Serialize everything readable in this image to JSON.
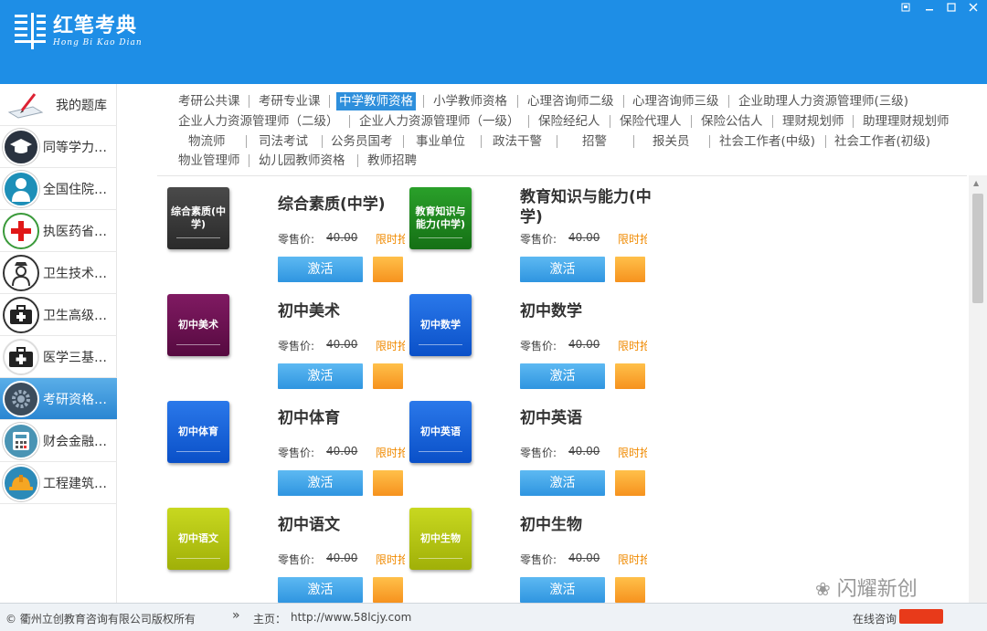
{
  "app": {
    "logo_cn": "红笔考典",
    "logo_en": "Hong Bi Kao Dian"
  },
  "colors": {
    "titlebar": "#1e8ee6",
    "accent": "#2e8fdc",
    "limited": "#f08a00"
  },
  "sidebar": {
    "items": [
      {
        "label": "我的题库",
        "icon": "pen-paper-icon"
      },
      {
        "label": "同等学力…",
        "icon": "graduation-cap-icon"
      },
      {
        "label": "全国住院…",
        "icon": "doctor-icon"
      },
      {
        "label": "执医药省…",
        "icon": "red-cross-icon"
      },
      {
        "label": "卫生技术…",
        "icon": "nurse-icon"
      },
      {
        "label": "卫生高级…",
        "icon": "medical-kit-icon"
      },
      {
        "label": "医学三基…",
        "icon": "first-aid-box-icon"
      },
      {
        "label": "考研资格…",
        "icon": "gear-icon"
      },
      {
        "label": "财会金融…",
        "icon": "calculator-icon"
      },
      {
        "label": "工程建筑…",
        "icon": "hard-hat-icon"
      }
    ]
  },
  "tabs": {
    "row1": [
      "考研公共课",
      "考研专业课",
      "中学教师资格",
      "小学教师资格",
      "心理咨询师二级",
      "心理咨询师三级",
      "企业助理人力资源管理师(三级)"
    ],
    "row2": [
      "企业人力资源管理师（二级）",
      "企业人力资源管理师（一级）",
      "保险经纪人",
      "保险代理人",
      "保险公估人",
      "理财规划师",
      "助理理财规划师"
    ],
    "row3": [
      "物流师",
      "司法考试",
      "公务员国考",
      "事业单位",
      "政法干警",
      "招警",
      "报关员",
      "社会工作者(中级)",
      "社会工作者(初级)"
    ],
    "row4": [
      "物业管理师",
      "幼儿园教师资格",
      "教师招聘"
    ],
    "active": "中学教师资格"
  },
  "products": [
    {
      "cover": "综合素质(中学)",
      "title": "综合素质(中学)",
      "color": "#3a3a3a"
    },
    {
      "cover": "教育知识与能力(中学)",
      "title": "教育知识与能力(中学)",
      "color": "#1f8a1f"
    },
    {
      "cover": "初中美术",
      "title": "初中美术",
      "color": "#6a1050"
    },
    {
      "cover": "初中数学",
      "title": "初中数学",
      "color": "#0f5fd8"
    },
    {
      "cover": "初中体育",
      "title": "初中体育",
      "color": "#0f5fd8"
    },
    {
      "cover": "初中英语",
      "title": "初中英语",
      "color": "#0f5fd8"
    },
    {
      "cover": "初中语文",
      "title": "初中语文",
      "color": "#b8c810"
    },
    {
      "cover": "初中生物",
      "title": "初中生物",
      "color": "#b8c810"
    }
  ],
  "product_labels": {
    "price_label": "零售价:",
    "price": "40.00",
    "limited": "限时抢",
    "activate": "激活"
  },
  "statusbar": {
    "copyright": "© 衢州立创教育咨询有限公司版权所有",
    "arrows": "»",
    "homepage_label": "主页：",
    "homepage_url": "http://www.58lcjy.com",
    "online": "在线咨询"
  },
  "watermark": "闪耀新创"
}
